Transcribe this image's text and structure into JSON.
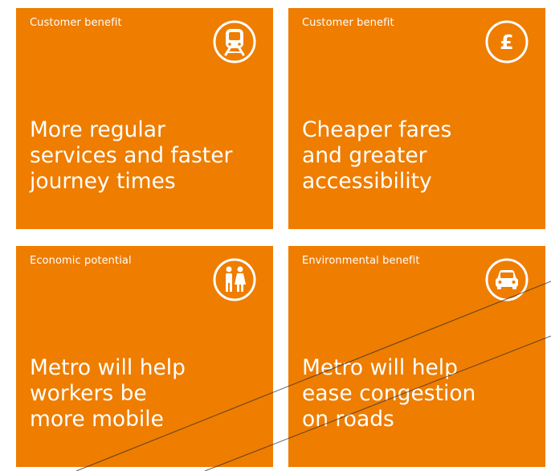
{
  "cards": [
    {
      "category": "Customer benefit",
      "headline_lines": [
        "More regular",
        "services and faster",
        "journey times"
      ],
      "icon": "train-icon"
    },
    {
      "category": "Customer benefit",
      "headline_lines": [
        "Cheaper fares",
        "and greater",
        "accessibility"
      ],
      "icon": "pound-icon",
      "icon_glyph": "£"
    },
    {
      "category": "Economic potential",
      "headline_lines": [
        "Metro will help",
        "workers be",
        "more mobile"
      ],
      "icon": "people-icon"
    },
    {
      "category": "Environmental benefit",
      "headline_lines": [
        "Metro will help",
        "ease congestion",
        "on roads"
      ],
      "icon": "car-icon"
    }
  ],
  "colors": {
    "card_background": "#ee7d00",
    "text": "#ffffff",
    "decor_lines": "#2a2a2a"
  }
}
